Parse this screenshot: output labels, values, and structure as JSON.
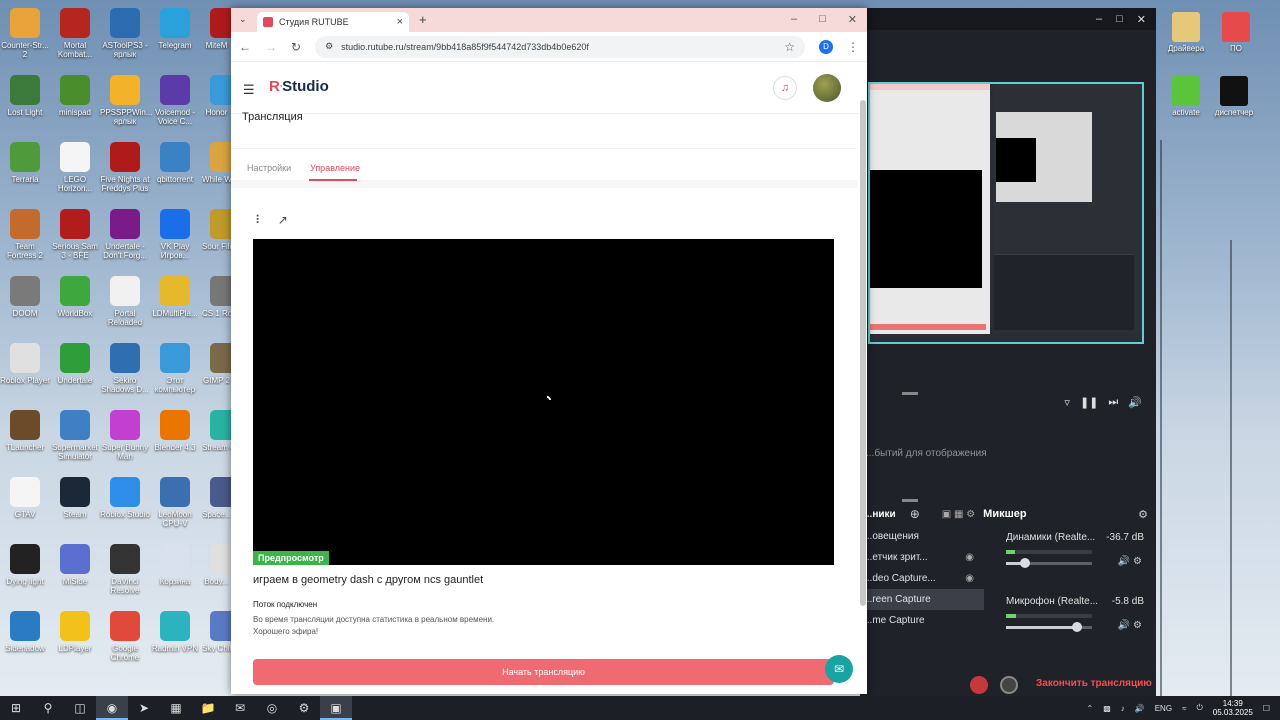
{
  "desktop": {
    "icons": [
      {
        "label": "Counter-Str... 2",
        "color": "#e8a33a"
      },
      {
        "label": "Mortal Kombat...",
        "color": "#b5261e"
      },
      {
        "label": "ASToolPS3 - ярлык",
        "color": "#2b6cb0"
      },
      {
        "label": "Telegram",
        "color": "#2aa1da"
      },
      {
        "label": "Lost Light",
        "color": "#3b7a3a"
      },
      {
        "label": "minispad",
        "color": "#4a8d2c"
      },
      {
        "label": "PPSSPPWin... ярлык",
        "color": "#f2b32b"
      },
      {
        "label": "Voicemod - Voice C...",
        "color": "#5a3ba8"
      },
      {
        "label": "Terraria",
        "color": "#4f9a3a"
      },
      {
        "label": "LEGO Horizon...",
        "color": "#f5f5f5"
      },
      {
        "label": "Five Nights at Freddys Plus",
        "color": "#b01a1a"
      },
      {
        "label": "qbittorrent",
        "color": "#3b82c4"
      },
      {
        "label": "Team Fortress 2",
        "color": "#c46a2c"
      },
      {
        "label": "Serious Sam 3 - BFE",
        "color": "#b11d1d"
      },
      {
        "label": "Undertale - Don't Forg...",
        "color": "#7a1b8a"
      },
      {
        "label": "VK Play Игров...",
        "color": "#1a6fe8"
      },
      {
        "label": "DOOM",
        "color": "#7a7a7a"
      },
      {
        "label": "WorldBox",
        "color": "#3ea83e"
      },
      {
        "label": "Portal Reloaded",
        "color": "#f0f0f0"
      },
      {
        "label": "LDMultiPla...",
        "color": "#e6b82c"
      },
      {
        "label": "Roblox Player",
        "color": "#e0e0e0"
      },
      {
        "label": "Undertale",
        "color": "#2e9e3b"
      },
      {
        "label": "Sekiro Shadows D...",
        "color": "#2f6fb0"
      },
      {
        "label": "Этот компьютер",
        "color": "#3a9ad9"
      },
      {
        "label": "TLauncher",
        "color": "#6b4b2a"
      },
      {
        "label": "Supermarket Simulator",
        "color": "#3f7fc4"
      },
      {
        "label": "Super Bunny Man",
        "color": "#c23fd1"
      },
      {
        "label": "Blender 4.3",
        "color": "#ea7600"
      },
      {
        "label": "GTAV",
        "color": "#f5f5f5"
      },
      {
        "label": "Steam",
        "color": "#1b2838"
      },
      {
        "label": "Roblox Studio",
        "color": "#2d8de8"
      },
      {
        "label": "LeoMoon CPU-V",
        "color": "#3b6fb0"
      },
      {
        "label": "Dying light",
        "color": "#222222"
      },
      {
        "label": "MiSide",
        "color": "#5a6fd0"
      },
      {
        "label": "DaVinci Resolve",
        "color": "#333333"
      },
      {
        "label": "Корзина",
        "color": "#d9e2ec"
      },
      {
        "label": "Sidenadow",
        "color": "#2a7ac4"
      },
      {
        "label": "LDPlayer",
        "color": "#f2c21b"
      },
      {
        "label": "Google Chrome",
        "color": "#e04a3a"
      },
      {
        "label": "Radmin VPN",
        "color": "#2bb3c0"
      }
    ],
    "partial_icons": [
      {
        "label": "MiteM",
        "color": "#b01a1a"
      },
      {
        "label": "Honor",
        "color": "#3a9ad9"
      },
      {
        "label": "While Waiti...",
        "color": "#d9a441"
      },
      {
        "label": "Sour Filmm...",
        "color": "#c09a2a"
      },
      {
        "label": "CS 1 Ross...",
        "color": "#777777"
      },
      {
        "label": "GIMP 2",
        "color": "#7a6a4a"
      },
      {
        "label": "Stream OB",
        "color": "#2ab3a3"
      },
      {
        "label": "Space...",
        "color": "#4a5a8a"
      },
      {
        "label": "Body...",
        "color": "#e0e0e0"
      },
      {
        "label": "Sky Chil... of the l...",
        "color": "#5a7ac4"
      }
    ],
    "right_icons": [
      {
        "label": "Драйвера",
        "color": "#e6c87a"
      },
      {
        "label": "ПО",
        "color": "#e64a4a"
      },
      {
        "label": "activate",
        "color": "#5ac43a"
      },
      {
        "label": "диспетчер",
        "color": "#111111"
      }
    ]
  },
  "obs": {
    "events_text": "...бытий для отображения",
    "mixer_title": "Микшер",
    "sources_title": "...ники",
    "sources": [
      "...овещения",
      "...етчик зрит...",
      "...deo Capture...",
      "...reen Capture",
      "...me Capture"
    ],
    "selected_source_index": 3,
    "channels": [
      {
        "name": "Динамики (Realte...",
        "db": "-36.7 dB",
        "meter": 0.1,
        "volume": 0.22
      },
      {
        "name": "Микрофон (Realte...",
        "db": "-5.8 dB",
        "meter": 0.12,
        "volume": 0.82
      }
    ],
    "stop_label": "Закончить трансляцию",
    "accent": "#5fcfcf"
  },
  "browser": {
    "tab_title": "Студия RUTUBE",
    "url": "studio.rutube.ru/stream/9bb418a85f9f544742d733db4b0e620f",
    "profile_letter": "D"
  },
  "app": {
    "logo_r": "R",
    "logo_text": "Studio",
    "page_title": "Трансляция",
    "tabs": [
      "Настройки",
      "Управление"
    ],
    "active_tab": 1,
    "preview_badge": "Предпросмотр",
    "stream_title": "играем в geometry dash с другом ncs gauntlet",
    "status": "Поток подключен",
    "info_line1": "Во время трансляции доступна статистика в реальном времени.",
    "info_line2": "Хорошего эфира!",
    "start_button": "Начать трансляцию",
    "accent": "#e2495a",
    "button_color": "#ef6b71"
  },
  "taskbar": {
    "lang": "ENG",
    "time": "14:39",
    "date": "05.03.2025"
  }
}
